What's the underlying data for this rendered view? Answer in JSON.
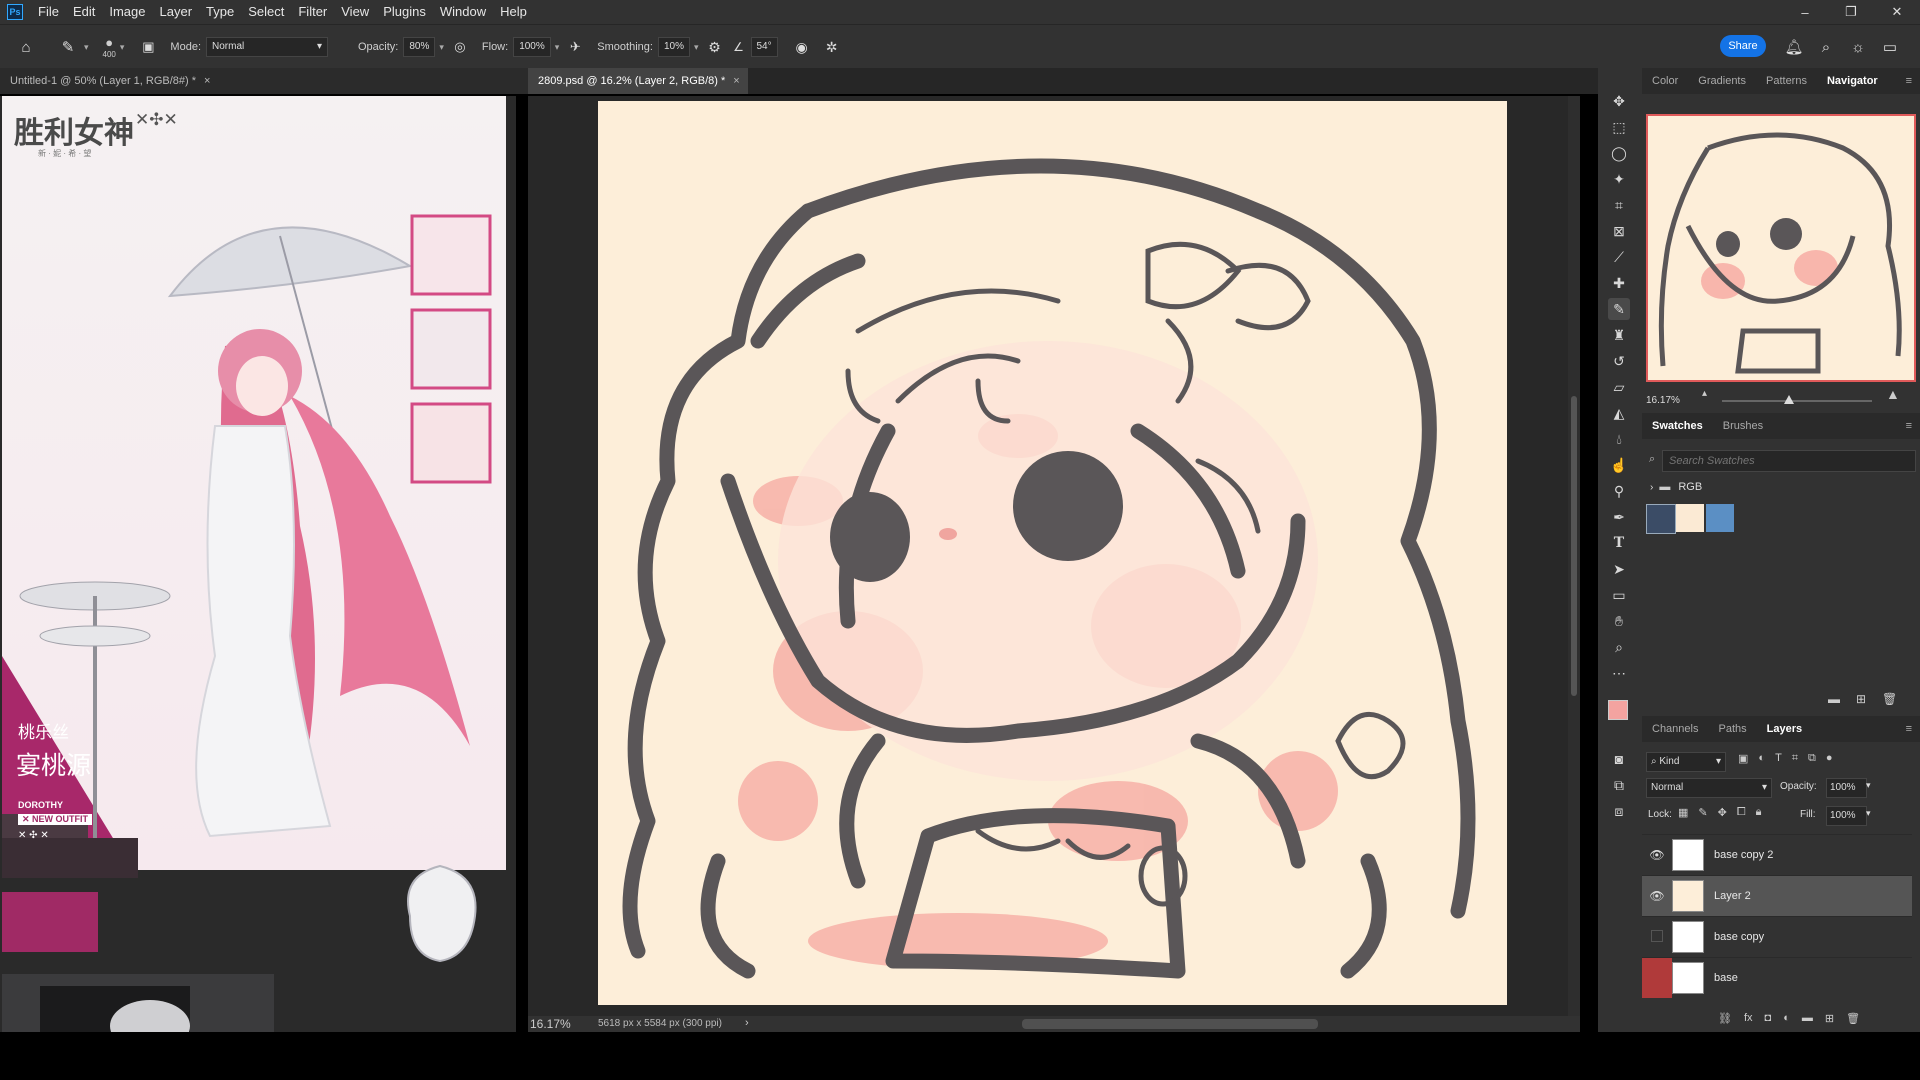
{
  "app": {
    "logo_text": "Ps"
  },
  "menu": [
    "File",
    "Edit",
    "Image",
    "Layer",
    "Type",
    "Select",
    "Filter",
    "View",
    "Plugins",
    "Window",
    "Help"
  ],
  "window_controls": {
    "minimize": "–",
    "restore": "❐",
    "close": "✕"
  },
  "options_bar": {
    "brush_size": "400",
    "mode_label": "Mode:",
    "mode_value": "Normal",
    "opacity_label": "Opacity:",
    "opacity_value": "80%",
    "flow_label": "Flow:",
    "flow_value": "100%",
    "smoothing_label": "Smoothing:",
    "smoothing_value": "10%",
    "angle_value": "54°",
    "share_label": "Share"
  },
  "tabs": {
    "left_doc": "Untitled-1 @ 50% (Layer 1, RGB/8#) *",
    "main_doc": "2809.psd @ 16.2% (Layer 2, RGB/8) *",
    "close": "×"
  },
  "reference": {
    "logo_title": "胜利女神",
    "logo_sub": "新 · 妮 · 希 · 望",
    "logo_marks": "✕✣✕",
    "name_small": "桃乐丝",
    "name_large": "宴桃源",
    "brand": "DOROTHY",
    "badge": "✕ NEW OUTFIT",
    "badge_marks": "✕ ✣ ✕"
  },
  "status": {
    "zoom": "16.17%",
    "doc_info": "5618 px x 5584 px (300 ppi)",
    "arrow": "›"
  },
  "panels": {
    "top_tabs": [
      "Color",
      "Gradients",
      "Patterns",
      "Navigator"
    ],
    "top_active": "Navigator",
    "nav_zoom": "16.17%",
    "swatch_tabs": [
      "Swatches",
      "Brushes"
    ],
    "swatch_active": "Swatches",
    "swatch_search_placeholder": "Search Swatches",
    "swatch_group": "RGB",
    "swatch_colors": [
      "#3b4c66",
      "#fbead4",
      "#5b8fc4"
    ],
    "layers_tabs": [
      "Channels",
      "Paths",
      "Layers"
    ],
    "layers_active": "Layers",
    "kind_label": "Kind",
    "blend_mode": "Normal",
    "opacity_label": "Opacity:",
    "opacity_value": "100%",
    "lock_label": "Lock:",
    "fill_label": "Fill:",
    "fill_value": "100%",
    "layers": [
      {
        "name": "base copy 2",
        "visible": true,
        "selected": false
      },
      {
        "name": "Layer 2",
        "visible": true,
        "selected": true
      },
      {
        "name": "base copy",
        "visible": false,
        "selected": false
      },
      {
        "name": "base",
        "visible": false,
        "selected": false
      }
    ]
  },
  "colors": {
    "ui_bg": "#323232",
    "accent": "#1473e6",
    "canvas": "#fdeed9",
    "stroke": "#5a5658",
    "blush": "#f6a8a0",
    "foreground": "#f3a3a0",
    "background": "#1e1e1e"
  }
}
